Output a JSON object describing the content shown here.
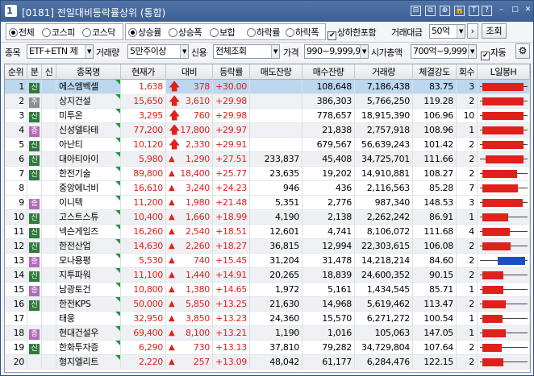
{
  "window": {
    "number": "1",
    "title": "[0181] 전일대비등락률상위 (통합)",
    "icons": [
      "layout-icon",
      "copy-icon",
      "link-icon",
      "lock-icon",
      "font-size-icon",
      "settings-icon",
      "minimize-icon",
      "maximize-icon",
      "close-icon"
    ],
    "icon_glyphs": [
      "⊟",
      "⧉",
      "⊕",
      "🔒",
      "T",
      "?",
      "–",
      "□",
      "✕"
    ]
  },
  "filters": {
    "market": {
      "options": [
        "전체",
        "코스피",
        "코스닥"
      ],
      "selected": "전체"
    },
    "direction": {
      "options": [
        "상승률",
        "상승폭",
        "보합",
        "하락률",
        "하락폭"
      ],
      "selected": "상승률"
    },
    "include_limit_label": "상하한포함",
    "include_limit_checked": true,
    "turnover_label": "거래대금",
    "turnover_value": "50억",
    "query_button": "조회",
    "item_label": "종목",
    "item_value": "ETF+ETN 제",
    "volume_label": "거래량",
    "volume_value": "5만주이상",
    "credit_label": "신용",
    "credit_value": "전체조회",
    "price_label": "가격",
    "price_value": "990~9,999,9",
    "mcap_label": "시가총액",
    "mcap_value": "700억~9,999",
    "auto_label": "자동",
    "auto_checked": true
  },
  "table": {
    "headers": [
      "순위",
      "분",
      "신",
      "종목명",
      "현재가",
      "대비",
      "등락률",
      "매도잔량",
      "매수잔량",
      "거래량",
      "체결강도",
      "회수",
      "L일봉H"
    ],
    "rows": [
      {
        "rank": "1",
        "div": "신",
        "div_type": "new",
        "credit": "",
        "name": "에스엠벡셀",
        "price": "1,638",
        "change": "378",
        "rate": "+30.00",
        "ask": "",
        "bid": "108,648",
        "volume": "7,186,438",
        "strength": "83.75",
        "count": "3",
        "limit": true,
        "bar": {
          "lo": 0.05,
          "hi": 0.92,
          "color": "#e0201a"
        }
      },
      {
        "rank": "2",
        "div": "주",
        "div_type": "ju",
        "credit": "",
        "name": "상지건설",
        "price": "15,650",
        "change": "3,610",
        "rate": "+29.98",
        "ask": "",
        "bid": "386,303",
        "volume": "5,766,250",
        "strength": "119.28",
        "count": "2",
        "limit": true,
        "bar": {
          "lo": 0.05,
          "hi": 0.92,
          "color": "#e0201a"
        }
      },
      {
        "rank": "3",
        "div": "신",
        "div_type": "new",
        "credit": "",
        "name": "미투온",
        "price": "3,295",
        "change": "760",
        "rate": "+29.98",
        "ask": "",
        "bid": "778,657",
        "volume": "18,915,390",
        "strength": "106.96",
        "count": "10",
        "limit": true,
        "bar": {
          "lo": 0.05,
          "hi": 0.92,
          "color": "#e0201a"
        }
      },
      {
        "rank": "4",
        "div": "증",
        "div_type": "jeung",
        "credit": "",
        "name": "신성델타테",
        "price": "77,200",
        "change": "17,800",
        "rate": "+29.97",
        "ask": "",
        "bid": "21,838",
        "volume": "2,757,918",
        "strength": "108.96",
        "count": "1",
        "limit": true,
        "bar": {
          "lo": 0.05,
          "hi": 0.92,
          "color": "#e0201a"
        }
      },
      {
        "rank": "5",
        "div": "신",
        "div_type": "new",
        "credit": "",
        "name": "아난티",
        "price": "10,120",
        "change": "2,330",
        "rate": "+29.91",
        "ask": "",
        "bid": "679,567",
        "volume": "56,639,243",
        "strength": "101.42",
        "count": "2",
        "limit": true,
        "bar": {
          "lo": 0.05,
          "hi": 0.92,
          "color": "#e0201a"
        }
      },
      {
        "rank": "6",
        "div": "신",
        "div_type": "new",
        "credit": "",
        "name": "대아티아이",
        "price": "5,980",
        "change": "1,290",
        "rate": "+27.51",
        "ask": "233,837",
        "bid": "45,408",
        "volume": "34,725,701",
        "strength": "111.66",
        "count": "2",
        "limit": false,
        "bar": {
          "lo": 0.12,
          "hi": 0.92,
          "color": "#e0201a"
        }
      },
      {
        "rank": "7",
        "div": "신",
        "div_type": "new",
        "credit": "",
        "name": "한전기술",
        "price": "89,800",
        "change": "18,400",
        "rate": "+25.77",
        "ask": "23,635",
        "bid": "19,202",
        "volume": "14,910,881",
        "strength": "108.27",
        "count": "2",
        "limit": false,
        "bar": {
          "lo": 0.05,
          "hi": 0.78,
          "color": "#e0201a"
        }
      },
      {
        "rank": "8",
        "div": "",
        "div_type": "",
        "credit": "",
        "name": "중앙에너비",
        "price": "16,610",
        "change": "3,240",
        "rate": "+24.23",
        "ask": "946",
        "bid": "436",
        "volume": "2,116,563",
        "strength": "85.28",
        "count": "7",
        "limit": false,
        "bar": {
          "lo": 0.05,
          "hi": 0.8,
          "color": "#e0201a"
        }
      },
      {
        "rank": "9",
        "div": "증",
        "div_type": "jeung",
        "credit": "",
        "name": "이니텍",
        "price": "11,200",
        "change": "1,980",
        "rate": "+21.48",
        "ask": "5,351",
        "bid": "2,776",
        "volume": "987,340",
        "strength": "148.53",
        "count": "3",
        "limit": false,
        "bar": {
          "lo": 0.05,
          "hi": 0.9,
          "color": "#e0201a"
        }
      },
      {
        "rank": "10",
        "div": "신",
        "div_type": "new",
        "credit": "",
        "name": "고스트스튜",
        "price": "10,400",
        "change": "1,660",
        "rate": "+18.99",
        "ask": "4,190",
        "bid": "2,138",
        "volume": "2,262,242",
        "strength": "86.91",
        "count": "1",
        "limit": false,
        "bar": {
          "lo": 0.05,
          "hi": 0.6,
          "color": "#e0201a"
        }
      },
      {
        "rank": "11",
        "div": "신",
        "div_type": "new",
        "credit": "",
        "name": "넥슨게임즈",
        "price": "16,260",
        "change": "2,540",
        "rate": "+18.51",
        "ask": "12,601",
        "bid": "4,741",
        "volume": "8,106,072",
        "strength": "111.68",
        "count": "4",
        "limit": false,
        "bar": {
          "lo": 0.05,
          "hi": 0.62,
          "color": "#e0201a"
        }
      },
      {
        "rank": "12",
        "div": "신",
        "div_type": "new",
        "credit": "",
        "name": "한전산업",
        "price": "14,630",
        "change": "2,260",
        "rate": "+18.27",
        "ask": "36,815",
        "bid": "12,994",
        "volume": "22,303,615",
        "strength": "106.08",
        "count": "2",
        "limit": false,
        "bar": {
          "lo": 0.05,
          "hi": 0.65,
          "color": "#e0201a"
        }
      },
      {
        "rank": "13",
        "div": "증",
        "div_type": "jeung",
        "credit": "",
        "name": "모나용평",
        "price": "5,530",
        "change": "740",
        "rate": "+15.45",
        "ask": "31,204",
        "bid": "31,478",
        "volume": "14,218,214",
        "strength": "84.60",
        "count": "2",
        "limit": false,
        "bar": {
          "lo": 0.38,
          "hi": 0.95,
          "color": "#1a4fc2"
        }
      },
      {
        "rank": "14",
        "div": "신",
        "div_type": "new",
        "credit": "",
        "name": "지투파워",
        "price": "11,100",
        "change": "1,440",
        "rate": "+14.91",
        "ask": "20,265",
        "bid": "18,839",
        "volume": "24,600,352",
        "strength": "90.15",
        "count": "2",
        "limit": false,
        "bar": {
          "lo": 0.05,
          "hi": 0.5,
          "color": "#e0201a"
        }
      },
      {
        "rank": "15",
        "div": "증",
        "div_type": "jeung",
        "credit": "",
        "name": "남광토건",
        "price": "10,800",
        "change": "1,380",
        "rate": "+14.65",
        "ask": "1,972",
        "bid": "5,161",
        "volume": "1,434,545",
        "strength": "85.71",
        "count": "1",
        "limit": false,
        "bar": {
          "lo": 0.05,
          "hi": 0.5,
          "color": "#e0201a"
        }
      },
      {
        "rank": "16",
        "div": "신",
        "div_type": "new",
        "credit": "",
        "name": "한전KPS",
        "price": "50,000",
        "change": "5,850",
        "rate": "+13.25",
        "ask": "21,630",
        "bid": "14,968",
        "volume": "5,619,462",
        "strength": "113.47",
        "count": "2",
        "limit": false,
        "bar": {
          "lo": 0.05,
          "hi": 0.55,
          "color": "#e0201a"
        }
      },
      {
        "rank": "17",
        "div": "",
        "div_type": "",
        "credit": "",
        "name": "태웅",
        "price": "32,950",
        "change": "3,850",
        "rate": "+13.23",
        "ask": "24,360",
        "bid": "15,570",
        "volume": "6,271,272",
        "strength": "100.54",
        "count": "1",
        "limit": false,
        "bar": {
          "lo": 0.05,
          "hi": 0.48,
          "color": "#e0201a"
        }
      },
      {
        "rank": "18",
        "div": "증",
        "div_type": "jeung",
        "credit": "",
        "name": "현대건설우",
        "price": "69,400",
        "change": "8,100",
        "rate": "+13.21",
        "ask": "1,190",
        "bid": "1,016",
        "volume": "105,063",
        "strength": "147.05",
        "count": "1",
        "limit": false,
        "bar": {
          "lo": 0.05,
          "hi": 0.55,
          "color": "#e0201a"
        }
      },
      {
        "rank": "19",
        "div": "신",
        "div_type": "new",
        "credit": "",
        "name": "한화투자증",
        "price": "6,290",
        "change": "730",
        "rate": "+13.13",
        "ask": "37,810",
        "bid": "79,282",
        "volume": "34,729,804",
        "strength": "107.64",
        "count": "2",
        "limit": false,
        "bar": {
          "lo": 0.05,
          "hi": 0.45,
          "color": "#e0201a"
        }
      },
      {
        "rank": "20",
        "div": "",
        "div_type": "",
        "credit": "",
        "name": "형지엘리트",
        "price": "2,220",
        "change": "257",
        "rate": "+13.09",
        "ask": "48,042",
        "bid": "61,177",
        "volume": "6,284,476",
        "strength": "122.15",
        "count": "2",
        "limit": false,
        "bar": {
          "lo": 0.05,
          "hi": 0.5,
          "color": "#e0201a"
        }
      }
    ]
  }
}
